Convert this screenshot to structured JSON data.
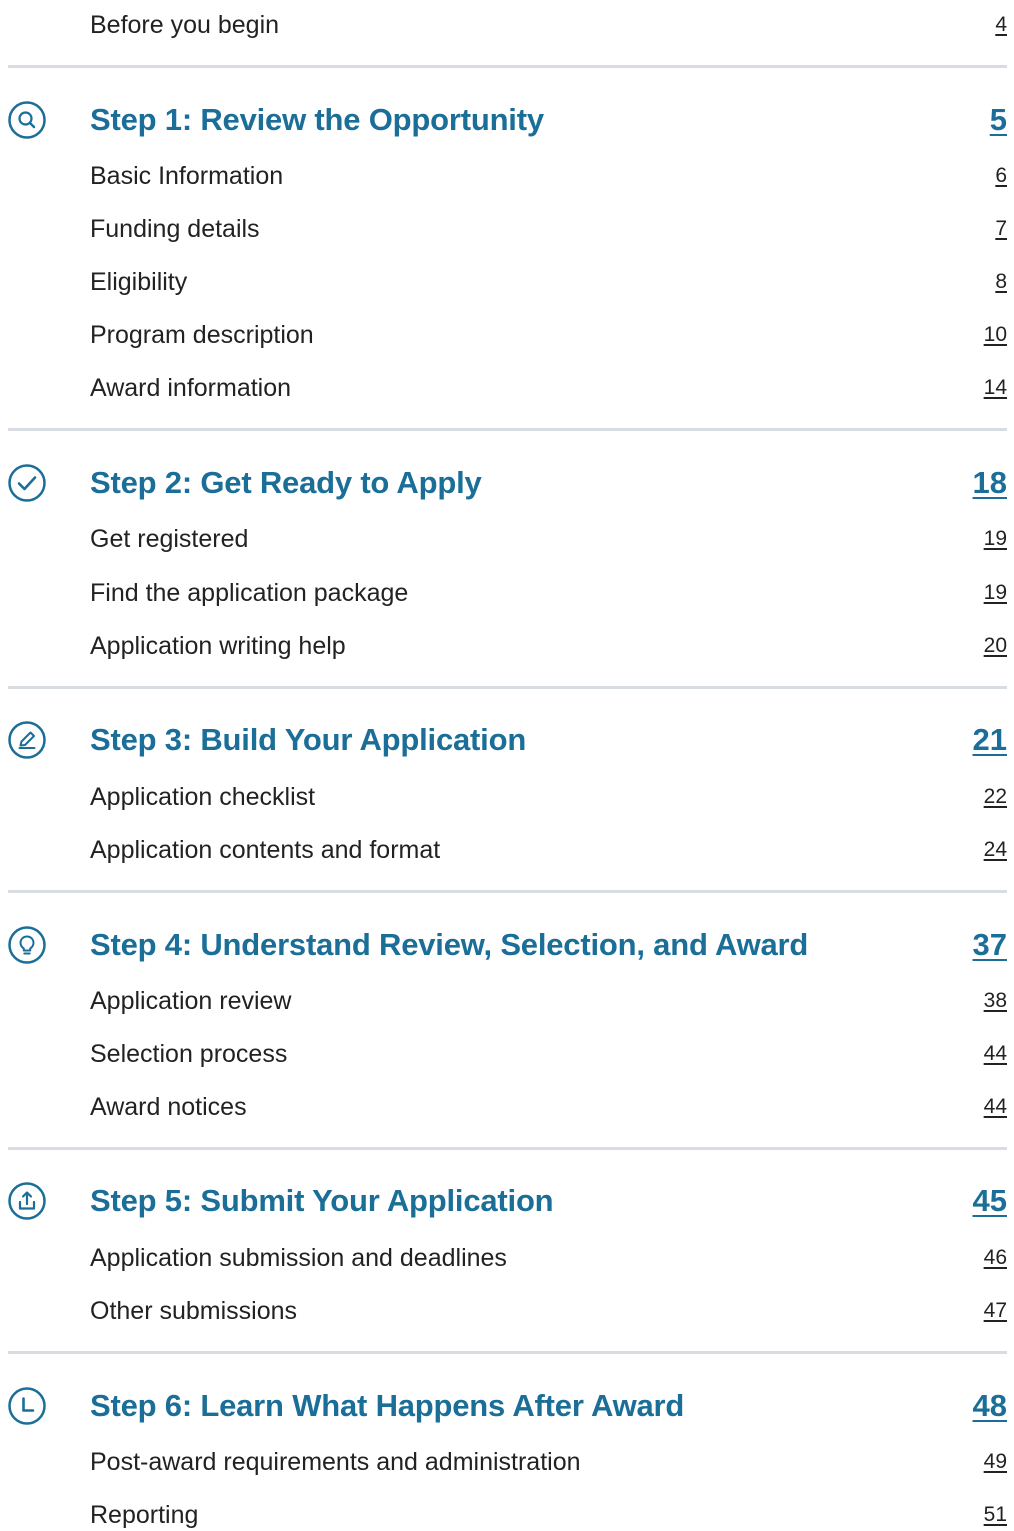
{
  "intro": {
    "label": "Before you begin",
    "page": "4"
  },
  "steps": [
    {
      "title": "Step 1: Review the Opportunity",
      "page": "5",
      "icon": "search-icon",
      "items": [
        {
          "label": "Basic Information",
          "page": "6"
        },
        {
          "label": "Funding details",
          "page": "7"
        },
        {
          "label": "Eligibility",
          "page": "8"
        },
        {
          "label": "Program description",
          "page": "10"
        },
        {
          "label": "Award information",
          "page": "14"
        }
      ]
    },
    {
      "title": "Step 2: Get Ready to Apply",
      "page": "18",
      "icon": "checkmark-icon",
      "items": [
        {
          "label": "Get registered",
          "page": "19"
        },
        {
          "label": "Find the application package",
          "page": "19"
        },
        {
          "label": "Application writing help",
          "page": "20"
        }
      ]
    },
    {
      "title": "Step 3: Build Your Application",
      "page": "21",
      "icon": "pencil-icon",
      "items": [
        {
          "label": "Application checklist",
          "page": "22"
        },
        {
          "label": "Application contents and format",
          "page": "24"
        }
      ]
    },
    {
      "title": "Step 4: Understand Review, Selection, and Award",
      "page": "37",
      "icon": "lightbulb-icon",
      "items": [
        {
          "label": "Application review",
          "page": "38"
        },
        {
          "label": "Selection process",
          "page": "44"
        },
        {
          "label": "Award notices",
          "page": "44"
        }
      ]
    },
    {
      "title": "Step 5: Submit Your Application",
      "page": "45",
      "icon": "upload-icon",
      "items": [
        {
          "label": "Application submission and deadlines",
          "page": "46"
        },
        {
          "label": "Other submissions",
          "page": "47"
        }
      ]
    },
    {
      "title": "Step 6: Learn What Happens After Award",
      "page": "48",
      "icon": "clock-icon",
      "items": [
        {
          "label": "Post-award requirements and administration",
          "page": "49"
        },
        {
          "label": "Reporting",
          "page": "51"
        }
      ]
    }
  ],
  "colors": {
    "accent": "#1a6e98",
    "text": "#222222",
    "divider": "#d7dde3"
  }
}
